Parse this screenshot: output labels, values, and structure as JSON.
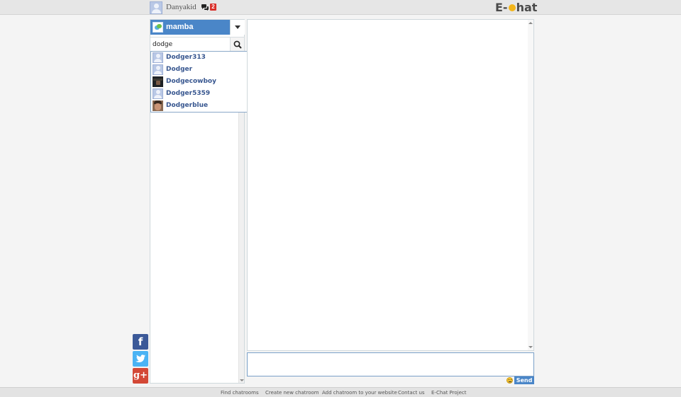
{
  "header": {
    "username": "Danyakid",
    "message_count": "2",
    "logo_prefix": "E-",
    "logo_suffix": "hat",
    "icons": {
      "avatar": "user-avatar-icon",
      "messages": "speech-bubbles-icon"
    }
  },
  "sidebar": {
    "room_name": "mamba",
    "search_value": "dodge",
    "search_placeholder": "",
    "icons": {
      "room": "room-icon",
      "toggle": "caret-down-icon",
      "search": "search-icon"
    }
  },
  "search_results": [
    {
      "name": "Dodger313",
      "avatar": "default"
    },
    {
      "name": "Dodger",
      "avatar": "default"
    },
    {
      "name": "Dodgecowboy",
      "avatar": "photo-cowboy"
    },
    {
      "name": "Dodger5359",
      "avatar": "default"
    },
    {
      "name": "Dodgerblue",
      "avatar": "photo-face"
    }
  ],
  "chat": {
    "message_value": "",
    "send_label": "Send",
    "icons": {
      "emoji": "emoji-icon"
    }
  },
  "social": {
    "facebook_glyph": "f",
    "googleplus_glyph": "g+",
    "icons": [
      "facebook-icon",
      "twitter-icon",
      "google-plus-icon"
    ]
  },
  "footer": {
    "links": [
      "Find chatrooms",
      "Create new chatroom",
      "Add chatroom to your website",
      "Contact us",
      "E-Chat Project"
    ]
  },
  "colors": {
    "accent": "#4a86c8",
    "badge": "#d9302b",
    "facebook": "#3b5998",
    "twitter": "#4ab3f4",
    "googleplus": "#d34836",
    "username_link": "#37568f"
  }
}
